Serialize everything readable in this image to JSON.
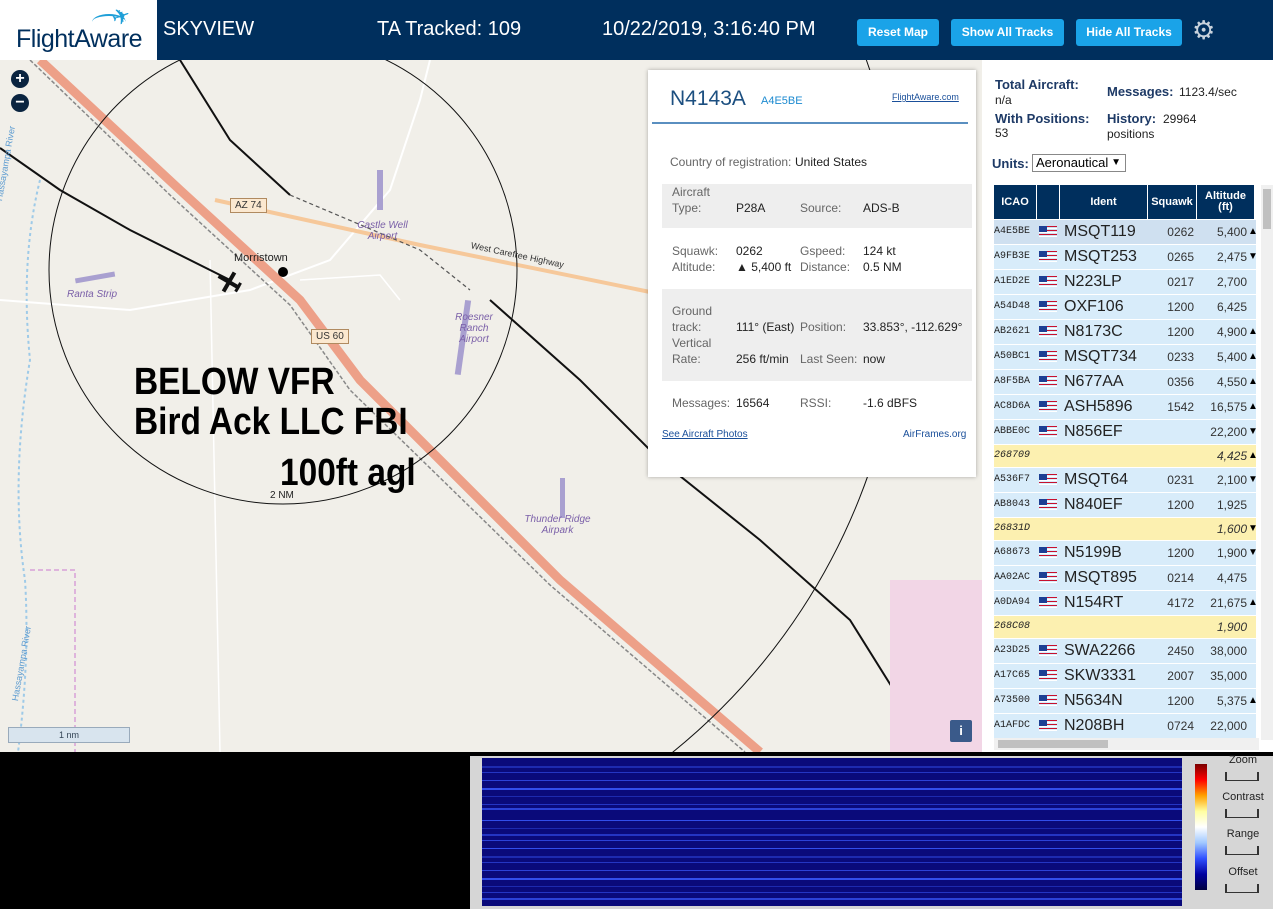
{
  "header": {
    "logo_text": "FlightAware",
    "app_name": "SKYVIEW",
    "tracked": "TA Tracked: 109",
    "datetime": "10/22/2019, 3:16:40 PM",
    "buttons": {
      "reset": "Reset Map",
      "show_all": "Show All Tracks",
      "hide_all": "Hide All Tracks"
    }
  },
  "map": {
    "town": "Morristown",
    "shields": {
      "az74": "AZ 74",
      "us60": "US 60"
    },
    "highway": "West Carefree Highway",
    "airports": {
      "castle_well": "Castle Well Airport",
      "ranta": "Ranta Strip",
      "roesner": "Roesner Ranch Airport",
      "thunder": "Thunder Ridge Airpark"
    },
    "river1": "Hassayampa River",
    "river2": "Hassayampa River",
    "overlay_line1": "BELOW VFR",
    "overlay_line2": "Bird Ack LLC FBI",
    "overlay_line3": "100ft agl",
    "range_label": "2 NM",
    "scale": "1 nm",
    "info": "i"
  },
  "popup": {
    "registration": "N4143A",
    "hex": "A4E5BE",
    "fa_link": "FlightAware.com",
    "country_label": "Country of registration:",
    "country": "United States",
    "type_label1": "Aircraft",
    "type_label2": "Type:",
    "type": "P28A",
    "source_label": "Source:",
    "source": "ADS-B",
    "squawk_label": "Squawk:",
    "squawk": "0262",
    "gspeed_label": "Gspeed:",
    "gspeed": "124 kt",
    "altitude_label": "Altitude:",
    "altitude": "▲ 5,400 ft",
    "distance_label": "Distance:",
    "distance": "0.5 NM",
    "track_label1": "Ground",
    "track_label2": "track:",
    "track": "111° (East)",
    "position_label": "Position:",
    "position": "33.853°, -112.629°",
    "vrate_label1": "Vertical",
    "vrate_label2": "Rate:",
    "vrate": "256 ft/min",
    "lastseen_label": "Last Seen:",
    "lastseen": "now",
    "messages_label": "Messages:",
    "messages": "16564",
    "rssi_label": "RSSI:",
    "rssi": "-1.6 dBFS",
    "photos_link": "See Aircraft Photos",
    "airframes_link": "AirFrames.org"
  },
  "stats": {
    "total_label": "Total Aircraft:",
    "total": "n/a",
    "messages_label": "Messages:",
    "messages": "1123.4/sec",
    "positions_label": "With Positions:",
    "positions": "53",
    "history_label": "History:",
    "history_value": "29964",
    "history_unit": "positions",
    "units_label": "Units:",
    "units": "Aeronautical"
  },
  "table": {
    "headers": {
      "icao": "ICAO",
      "ident": "Ident",
      "squawk": "Squawk",
      "alt1": "Altitude",
      "alt2": "(ft)"
    },
    "rows": [
      {
        "icao": "A4E5BE",
        "ident": "MSQT119",
        "squawk": "0262",
        "alt": "5,400",
        "trend": "▲",
        "flag": true
      },
      {
        "icao": "A9FB3E",
        "ident": "MSQT253",
        "squawk": "0265",
        "alt": "2,475",
        "trend": "▼",
        "flag": true
      },
      {
        "icao": "A1ED2E",
        "ident": "N223LP",
        "squawk": "0217",
        "alt": "2,700",
        "trend": "",
        "flag": true
      },
      {
        "icao": "A54D48",
        "ident": "OXF106",
        "squawk": "1200",
        "alt": "6,425",
        "trend": "",
        "flag": true
      },
      {
        "icao": "AB2621",
        "ident": "N8173C",
        "squawk": "1200",
        "alt": "4,900",
        "trend": "▲",
        "flag": true
      },
      {
        "icao": "A50BC1",
        "ident": "MSQT734",
        "squawk": "0233",
        "alt": "5,400",
        "trend": "▲",
        "flag": true
      },
      {
        "icao": "A8F5BA",
        "ident": "N677AA",
        "squawk": "0356",
        "alt": "4,550",
        "trend": "▲",
        "flag": true
      },
      {
        "icao": "AC8D6A",
        "ident": "ASH5896",
        "squawk": "1542",
        "alt": "16,575",
        "trend": "▲",
        "flag": true
      },
      {
        "icao": "ABBE0C",
        "ident": "N856EF",
        "squawk": "",
        "alt": "22,200",
        "trend": "▼",
        "flag": true
      },
      {
        "icao": "268709",
        "ident": "",
        "squawk": "",
        "alt": "4,425",
        "trend": "▲",
        "flag": false
      },
      {
        "icao": "A536F7",
        "ident": "MSQT64",
        "squawk": "0231",
        "alt": "2,100",
        "trend": "▼",
        "flag": true
      },
      {
        "icao": "AB8043",
        "ident": "N840EF",
        "squawk": "1200",
        "alt": "1,925",
        "trend": "",
        "flag": true
      },
      {
        "icao": "26831D",
        "ident": "",
        "squawk": "",
        "alt": "1,600",
        "trend": "▼",
        "flag": false
      },
      {
        "icao": "A68673",
        "ident": "N5199B",
        "squawk": "1200",
        "alt": "1,900",
        "trend": "▼",
        "flag": true
      },
      {
        "icao": "AA02AC",
        "ident": "MSQT895",
        "squawk": "0214",
        "alt": "4,475",
        "trend": "",
        "flag": true
      },
      {
        "icao": "A0DA94",
        "ident": "N154RT",
        "squawk": "4172",
        "alt": "21,675",
        "trend": "▲",
        "flag": true
      },
      {
        "icao": "268C08",
        "ident": "",
        "squawk": "",
        "alt": "1,900",
        "trend": "",
        "flag": false
      },
      {
        "icao": "A23D25",
        "ident": "SWA2266",
        "squawk": "2450",
        "alt": "38,000",
        "trend": "",
        "flag": true
      },
      {
        "icao": "A17C65",
        "ident": "SKW3331",
        "squawk": "2007",
        "alt": "35,000",
        "trend": "",
        "flag": true
      },
      {
        "icao": "A73500",
        "ident": "N5634N",
        "squawk": "1200",
        "alt": "5,375",
        "trend": "▲",
        "flag": true
      },
      {
        "icao": "A1AFDC",
        "ident": "N208BH",
        "squawk": "0724",
        "alt": "22,000",
        "trend": "",
        "flag": true
      }
    ]
  },
  "spectrum": {
    "zoom": "Zoom",
    "contrast": "Contrast",
    "range": "Range",
    "offset": "Offset"
  },
  "colors": {
    "header_bg": "#002f5d",
    "button": "#1aa3e8",
    "row_blue": "#d8ecfa",
    "row_yellow": "#fcf0b0"
  }
}
